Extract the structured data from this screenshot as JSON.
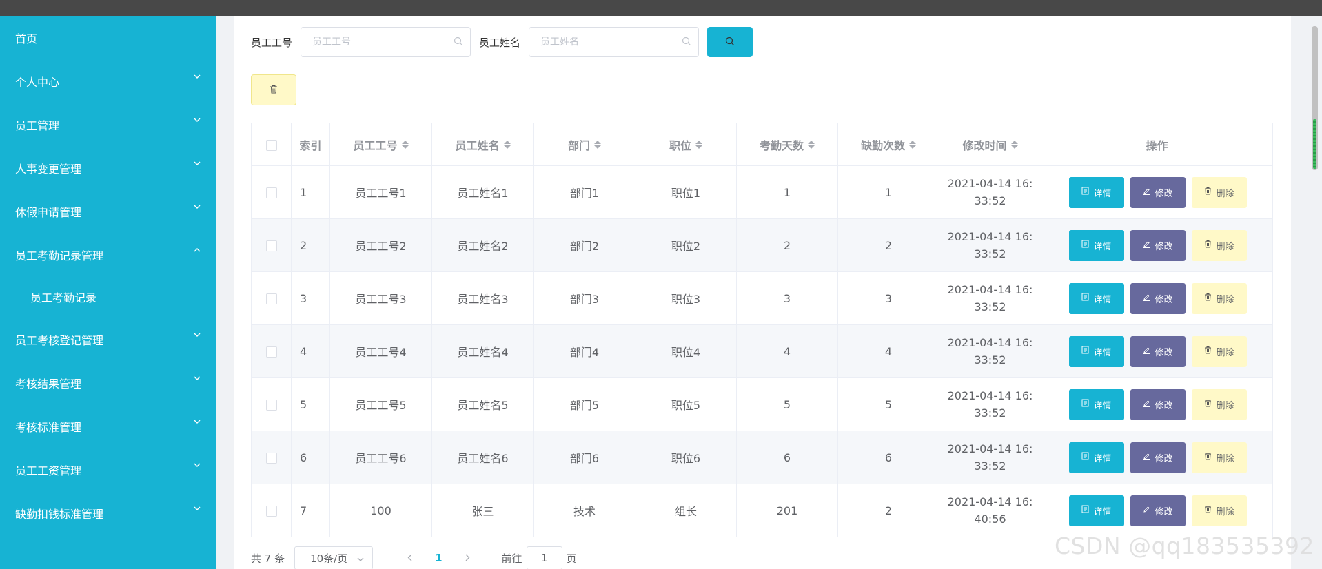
{
  "sidebar": {
    "items": [
      {
        "label": "首页",
        "expandable": false
      },
      {
        "label": "个人中心",
        "expandable": true,
        "expanded": false
      },
      {
        "label": "员工管理",
        "expandable": true,
        "expanded": false
      },
      {
        "label": "人事变更管理",
        "expandable": true,
        "expanded": false
      },
      {
        "label": "休假申请管理",
        "expandable": true,
        "expanded": false
      },
      {
        "label": "员工考勤记录管理",
        "expandable": true,
        "expanded": true
      },
      {
        "label": "员工考核登记管理",
        "expandable": true,
        "expanded": false
      },
      {
        "label": "考核结果管理",
        "expandable": true,
        "expanded": false
      },
      {
        "label": "考核标准管理",
        "expandable": true,
        "expanded": false
      },
      {
        "label": "员工工资管理",
        "expandable": true,
        "expanded": false
      },
      {
        "label": "缺勤扣钱标准管理",
        "expandable": true,
        "expanded": false
      }
    ],
    "sub_item": "员工考勤记录"
  },
  "search": {
    "emp_no_label": "员工工号",
    "emp_no_placeholder": "员工工号",
    "emp_name_label": "员工姓名",
    "emp_name_placeholder": "员工姓名"
  },
  "table": {
    "headers": [
      "索引",
      "员工工号",
      "员工姓名",
      "部门",
      "职位",
      "考勤天数",
      "缺勤次数",
      "修改时间",
      "操作"
    ],
    "rows": [
      {
        "idx": "1",
        "no": "员工工号1",
        "name": "员工姓名1",
        "dept": "部门1",
        "pos": "职位1",
        "days": "1",
        "absent": "1",
        "time1": "2021-04-14 16:",
        "time2": "33:52"
      },
      {
        "idx": "2",
        "no": "员工工号2",
        "name": "员工姓名2",
        "dept": "部门2",
        "pos": "职位2",
        "days": "2",
        "absent": "2",
        "time1": "2021-04-14 16:",
        "time2": "33:52"
      },
      {
        "idx": "3",
        "no": "员工工号3",
        "name": "员工姓名3",
        "dept": "部门3",
        "pos": "职位3",
        "days": "3",
        "absent": "3",
        "time1": "2021-04-14 16:",
        "time2": "33:52"
      },
      {
        "idx": "4",
        "no": "员工工号4",
        "name": "员工姓名4",
        "dept": "部门4",
        "pos": "职位4",
        "days": "4",
        "absent": "4",
        "time1": "2021-04-14 16:",
        "time2": "33:52"
      },
      {
        "idx": "5",
        "no": "员工工号5",
        "name": "员工姓名5",
        "dept": "部门5",
        "pos": "职位5",
        "days": "5",
        "absent": "5",
        "time1": "2021-04-14 16:",
        "time2": "33:52"
      },
      {
        "idx": "6",
        "no": "员工工号6",
        "name": "员工姓名6",
        "dept": "部门6",
        "pos": "职位6",
        "days": "6",
        "absent": "6",
        "time1": "2021-04-14 16:",
        "time2": "33:52"
      },
      {
        "idx": "7",
        "no": "100",
        "name": "张三",
        "dept": "技术",
        "pos": "组长",
        "days": "201",
        "absent": "2",
        "time1": "2021-04-14 16:",
        "time2": "40:56"
      }
    ],
    "ops": {
      "detail": "详情",
      "edit": "修改",
      "delete": "删除"
    }
  },
  "pager": {
    "total": "共 7 条",
    "page_size": "10条/页",
    "current": "1",
    "goto_prefix": "前往",
    "goto_value": "1",
    "goto_suffix": "页"
  },
  "watermark": "CSDN @qq183535392",
  "colors": {
    "sidebar": "#17b3d3",
    "primary": "#17b3d3",
    "edit": "#67699d",
    "delete": "#fff9c8"
  }
}
